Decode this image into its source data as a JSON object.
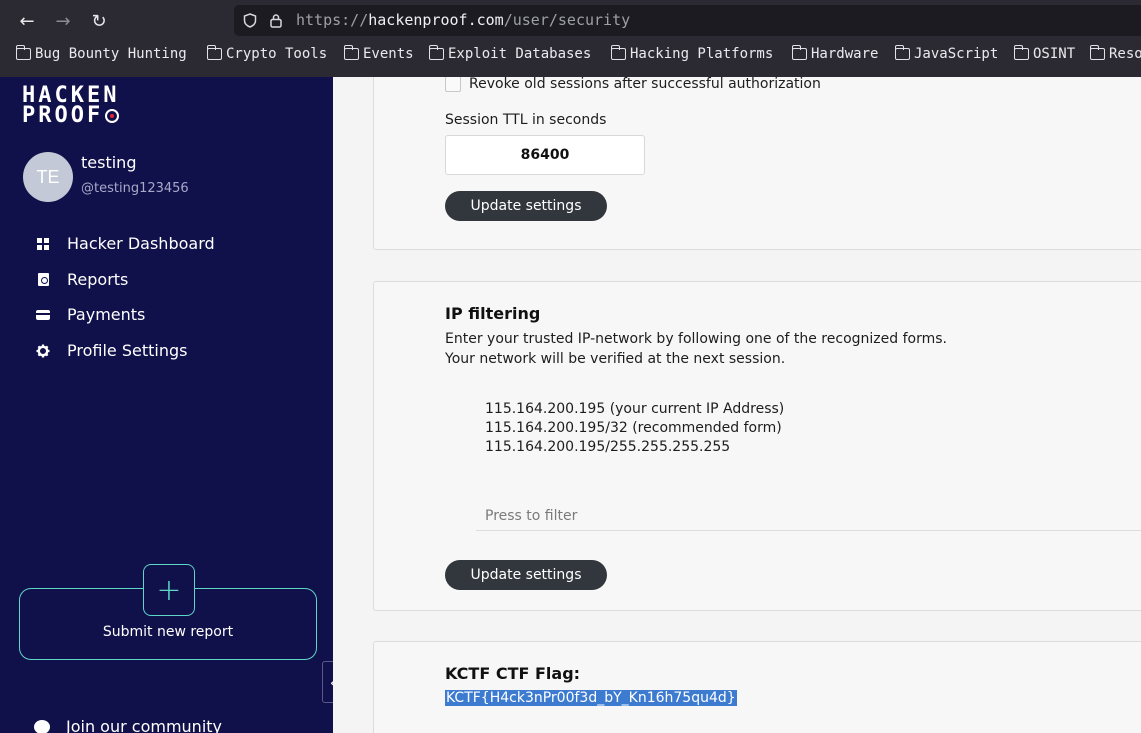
{
  "browser": {
    "url_scheme": "https://",
    "url_host": "hackenproof.com",
    "url_path": "/user/security",
    "bookmarks": [
      "Bug Bounty Hunting",
      "Crypto Tools",
      "Events",
      "Exploit Databases",
      "Hacking Platforms",
      "Hardware",
      "JavaScript",
      "OSINT",
      "Reso"
    ]
  },
  "sidebar": {
    "logo_line1": "HACKEN",
    "logo_line2": "PROOF",
    "avatar_initials": "TE",
    "user_name": "testing",
    "user_handle": "@testing123456",
    "nav": [
      {
        "label": "Hacker Dashboard",
        "icon": "dashboard-icon"
      },
      {
        "label": "Reports",
        "icon": "report-icon"
      },
      {
        "label": "Payments",
        "icon": "card-icon"
      },
      {
        "label": "Profile Settings",
        "icon": "gear-icon"
      }
    ],
    "submit_plus": "+",
    "submit_label": "Submit new report",
    "community_label": "Join our community",
    "collapse_glyph": "‹"
  },
  "session": {
    "revoke_label": "Revoke old sessions after successful authorization",
    "ttl_label": "Session TTL in seconds",
    "ttl_value": "86400",
    "update_label": "Update settings"
  },
  "ip_filtering": {
    "title": "IP filtering",
    "desc_line1": "Enter your trusted IP-network by following one of the recognized forms.",
    "desc_line2": "Your network will be verified at the next session.",
    "examples": [
      "115.164.200.195 (your current IP Address)",
      "115.164.200.195/32 (recommended form)",
      "115.164.200.195/255.255.255.255"
    ],
    "filter_placeholder": "Press to filter",
    "update_label": "Update settings"
  },
  "flag_card": {
    "title": "KCTF CTF Flag:",
    "flag": "KCTF{H4ck3nPr00f3d_bY_Kn16h75qu4d}"
  },
  "colors": {
    "sidebar_bg": "#10104a",
    "accent": "#5fd6c8",
    "button_bg": "#32373d",
    "selection": "#3d7bd1"
  }
}
